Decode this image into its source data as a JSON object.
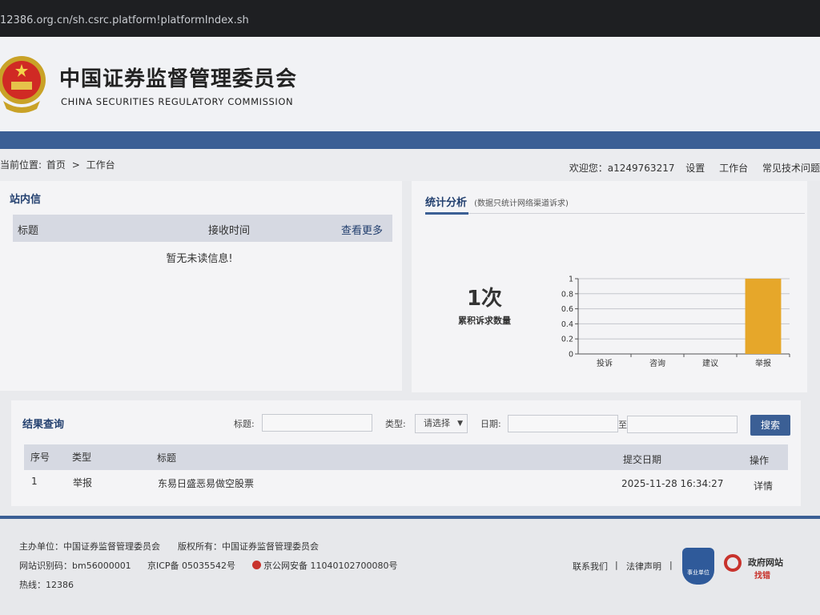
{
  "browser": {
    "url": "12386.org.cn/sh.csrc.platform!platformIndex.sh"
  },
  "header": {
    "org_cn": "中国证券监督管理委员会",
    "org_en": "CHINA SECURITIES REGULATORY COMMISSION",
    "emblem_icon": "national-emblem-icon"
  },
  "breadcrumb": {
    "prefix": "当前位置:",
    "home": "首页",
    "sep": ">",
    "current": "工作台"
  },
  "user_nav": {
    "welcome": "欢迎您：a1249763217",
    "settings": "设置",
    "workbench": "工作台",
    "faq": "常见技术问题"
  },
  "messages": {
    "title": "站内信",
    "col_title": "标题",
    "col_time": "接收时间",
    "more": "查看更多",
    "empty": "暂无未读信息!"
  },
  "stats": {
    "title": "统计分析",
    "note": "(数据只统计网络渠道诉求)",
    "count": "1次",
    "count_label": "累积诉求数量"
  },
  "chart_data": {
    "type": "bar",
    "categories": [
      "投诉",
      "咨询",
      "建议",
      "举报"
    ],
    "values": [
      0,
      0,
      0,
      1
    ],
    "yticks": [
      "0",
      "0.2",
      "0.4",
      "0.6",
      "0.8",
      "1"
    ],
    "ylim": [
      0,
      1
    ],
    "grid": true,
    "bar_color": "#e6a72a"
  },
  "query": {
    "title": "结果查询",
    "title_label": "标题:",
    "type_label": "类型:",
    "type_value": "请选择",
    "date_label": "日期:",
    "date_to": "至",
    "search": "搜索",
    "columns": {
      "no": "序号",
      "type": "类型",
      "title": "标题",
      "date": "提交日期",
      "action": "操作"
    },
    "rows": [
      {
        "no": "1",
        "type": "举报",
        "title": "东易日盛恶易做空股票",
        "date": "2025-11-28 16:34:27",
        "action": "详情"
      }
    ]
  },
  "footer": {
    "sponsor": "主办单位：中国证券监督管理委员会",
    "copyright": "版权所有：中国证券监督管理委员会",
    "site_id": "网站识别码：bm56000001",
    "icp": "京ICP备 05035542号",
    "police": "京公网安备 11040102700080号",
    "hotline": "热线：12386",
    "contact": "联系我们",
    "sep": "|",
    "legal": "法律声明",
    "badge1_text": "事业单位",
    "badge2_line1": "政府网站",
    "badge2_line2": "找错"
  },
  "colors": {
    "brand_blue": "#3b5f95",
    "title_blue": "#23406f",
    "bar": "#e6a72a"
  }
}
